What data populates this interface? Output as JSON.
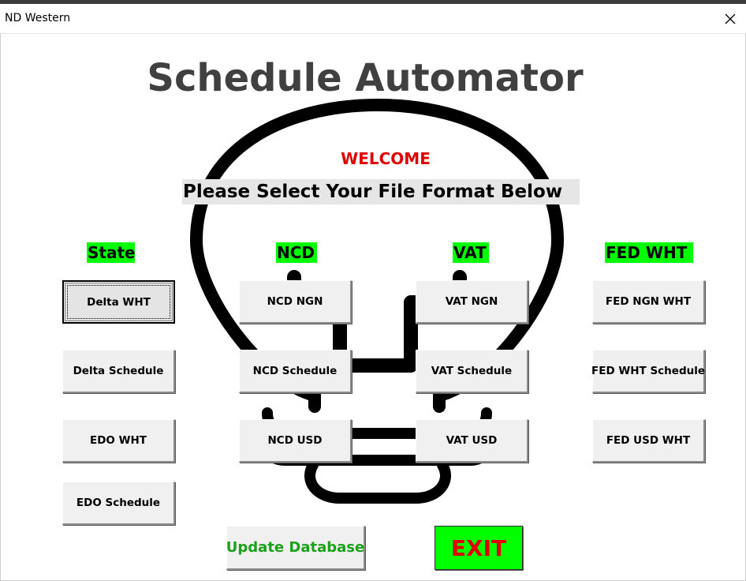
{
  "window": {
    "title": "ND Western"
  },
  "form": {
    "heading": "Schedule Automator",
    "welcome": "WELCOME",
    "subtitle": "Please Select Your File Format Below",
    "columns": {
      "state": {
        "label": "State",
        "buttons": [
          "Delta WHT",
          "Delta Schedule",
          "EDO WHT",
          "EDO Schedule"
        ]
      },
      "ncd": {
        "label": "NCD",
        "buttons": [
          "NCD NGN",
          "NCD Schedule",
          "NCD USD"
        ]
      },
      "vat": {
        "label": "VAT",
        "buttons": [
          "VAT NGN",
          "VAT Schedule",
          "VAT USD"
        ]
      },
      "fed": {
        "label": "FED WHT",
        "buttons": [
          "FED NGN WHT",
          "FED WHT Schedule",
          "FED USD WHT"
        ]
      }
    },
    "actions": {
      "update": "Update Database",
      "exit": "EXIT"
    }
  },
  "colors": {
    "label_bg": "#00ff00",
    "welcome": "#e00000",
    "update_text": "#1aa11a",
    "exit_bg": "#00ff00",
    "exit_text": "#e00000",
    "heading": "#404040"
  },
  "icons": {
    "close": "close-icon",
    "background": "lightbulb-icon"
  }
}
